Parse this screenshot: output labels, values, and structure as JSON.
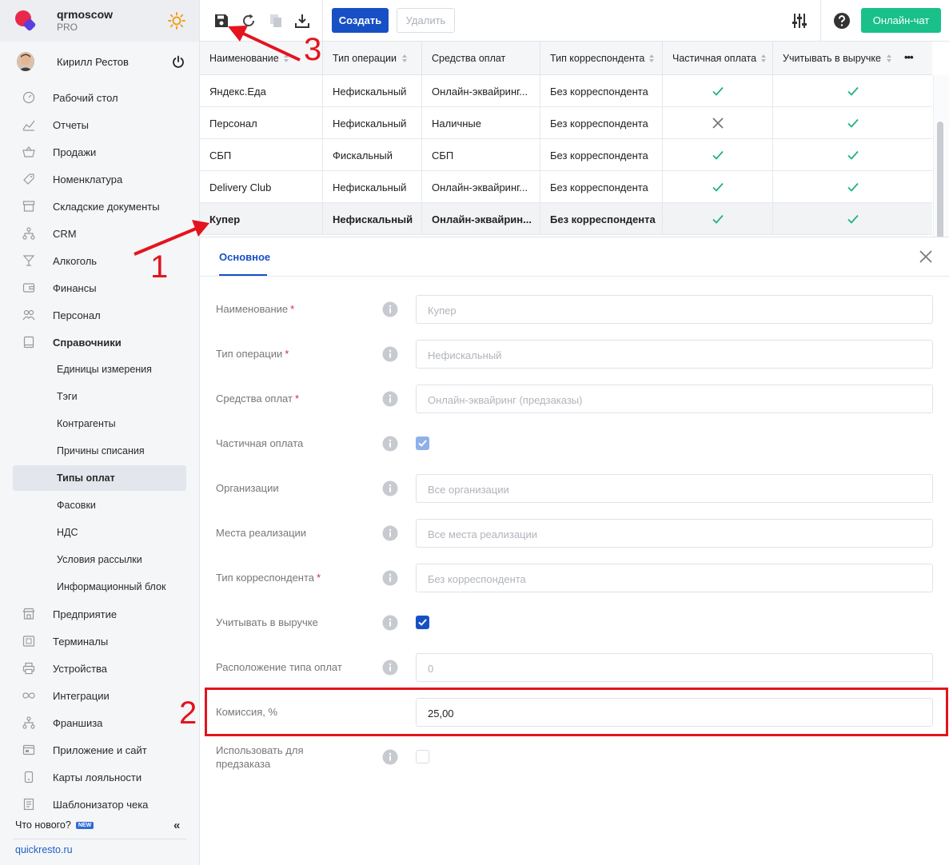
{
  "brand": {
    "name": "qrmoscow",
    "plan": "PRO"
  },
  "user": {
    "name": "Кирилл Рестов"
  },
  "nav": [
    {
      "label": "Рабочий стол",
      "icon": "dashboard-icon"
    },
    {
      "label": "Отчеты",
      "icon": "chart-icon"
    },
    {
      "label": "Продажи",
      "icon": "basket-icon"
    },
    {
      "label": "Номенклатура",
      "icon": "tag-icon"
    },
    {
      "label": "Складские документы",
      "icon": "archive-icon"
    },
    {
      "label": "CRM",
      "icon": "hierarchy-icon"
    },
    {
      "label": "Алкоголь",
      "icon": "glass-icon"
    },
    {
      "label": "Финансы",
      "icon": "wallet-icon"
    },
    {
      "label": "Персонал",
      "icon": "people-icon"
    },
    {
      "label": "Справочники",
      "icon": "book-icon"
    },
    {
      "label": "Единицы измерения"
    },
    {
      "label": "Тэги"
    },
    {
      "label": "Контрагенты"
    },
    {
      "label": "Причины списания"
    },
    {
      "label": "Типы оплат"
    },
    {
      "label": "Фасовки"
    },
    {
      "label": "НДС"
    },
    {
      "label": "Условия рассылки"
    },
    {
      "label": "Информационный блок"
    },
    {
      "label": "Предприятие",
      "icon": "store-icon"
    },
    {
      "label": "Терминалы",
      "icon": "terminal-icon"
    },
    {
      "label": "Устройства",
      "icon": "printer-icon"
    },
    {
      "label": "Интеграции",
      "icon": "infinity-icon"
    },
    {
      "label": "Франшиза",
      "icon": "hierarchy-icon"
    },
    {
      "label": "Приложение и сайт",
      "icon": "app-icon"
    },
    {
      "label": "Карты лояльности",
      "icon": "card-icon"
    },
    {
      "label": "Шаблонизатор чека",
      "icon": "receipt-icon"
    }
  ],
  "footer": {
    "whats_new": "Что нового?",
    "new_badge": "NEW",
    "collapse": "«",
    "site": "quickresto.ru"
  },
  "toolbar": {
    "create": "Создать",
    "delete": "Удалить",
    "chat": "Онлайн-чат"
  },
  "table": {
    "columns": [
      "Наименование",
      "Тип операции",
      "Средства оплат",
      "Тип корреспондента",
      "Частичная оплата",
      "Учитывать в выручке"
    ],
    "more": "•••",
    "rows": [
      {
        "name": "Яндекс.Еда",
        "op": "Нефискальный",
        "means": "Онлайн-эквайринг...",
        "corr": "Без корреспондента",
        "partial": true,
        "revenue": true
      },
      {
        "name": "Персонал",
        "op": "Нефискальный",
        "means": "Наличные",
        "corr": "Без корреспондента",
        "partial": false,
        "revenue": true
      },
      {
        "name": "СБП",
        "op": "Фискальный",
        "means": "СБП",
        "corr": "Без корреспондента",
        "partial": true,
        "revenue": true
      },
      {
        "name": "Delivery Club",
        "op": "Нефискальный",
        "means": "Онлайн-эквайринг...",
        "corr": "Без корреспондента",
        "partial": true,
        "revenue": true
      },
      {
        "name": "Купер",
        "op": "Нефискальный",
        "means": "Онлайн-эквайрин...",
        "corr": "Без корреспондента",
        "partial": true,
        "revenue": true
      }
    ]
  },
  "form": {
    "tab": "Основное",
    "fields": [
      {
        "label": "Наименование",
        "required": true,
        "type": "input",
        "value": "Купер"
      },
      {
        "label": "Тип операции",
        "required": true,
        "type": "input",
        "value": "Нефискальный"
      },
      {
        "label": "Средства оплат",
        "required": true,
        "type": "input",
        "value": "Онлайн-эквайринг (предзаказы)"
      },
      {
        "label": "Частичная оплата",
        "required": false,
        "type": "checkbox",
        "checked": true,
        "disabled": true
      },
      {
        "label": "Организации",
        "required": false,
        "type": "input",
        "value": "Все организации"
      },
      {
        "label": "Места реализации",
        "required": false,
        "type": "input",
        "value": "Все места реализации"
      },
      {
        "label": "Тип корреспондента",
        "required": true,
        "type": "input",
        "value": "Без корреспондента"
      },
      {
        "label": "Учитывать в выручке",
        "required": false,
        "type": "checkbox",
        "checked": true,
        "disabled": false
      },
      {
        "label": "Расположение типа оплат",
        "required": false,
        "type": "input",
        "value": "0"
      },
      {
        "label": "Комиссия, %",
        "required": false,
        "type": "input",
        "value": "25,00",
        "active": true
      },
      {
        "label": "Использовать для предзаказа",
        "required": false,
        "type": "checkbox",
        "checked": false,
        "disabled": false
      }
    ]
  },
  "annotations": {
    "one": "1",
    "two": "2",
    "three": "3"
  },
  "colors": {
    "accent": "#1750c4",
    "chat": "#19c08a",
    "annotation": "#e3141e",
    "check": "#1bb37f"
  }
}
